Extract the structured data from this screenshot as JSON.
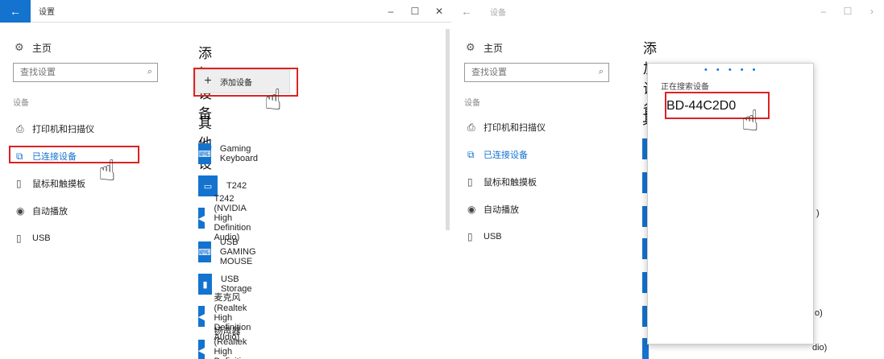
{
  "left_window": {
    "title": "设置",
    "back_glyph": "←",
    "minimize_glyph": "–",
    "maximize_glyph": "☐",
    "close_glyph": "✕",
    "sidebar": {
      "home_label": "主页",
      "search_placeholder": "查找设置",
      "group_label": "设备",
      "items": [
        {
          "label": "打印机和扫描仪",
          "icon": "printer-icon"
        },
        {
          "label": "已连接设备",
          "icon": "connected-devices-icon",
          "active": true
        },
        {
          "label": "鼠标和触摸板",
          "icon": "mouse-icon"
        },
        {
          "label": "自动播放",
          "icon": "autoplay-icon"
        },
        {
          "label": "USB",
          "icon": "usb-icon"
        }
      ]
    },
    "content": {
      "add_heading": "添加设备",
      "add_button_label": "添加设备",
      "other_heading": "其他设备",
      "devices": [
        {
          "name": "Gaming Keyboard",
          "icon": "keyboard-icon"
        },
        {
          "name": "T242",
          "icon": "monitor-icon"
        },
        {
          "name": "T242 (NVIDIA High Definition Audio)",
          "icon": "speaker-icon"
        },
        {
          "name": "USB GAMING MOUSE",
          "icon": "keyboard-icon"
        },
        {
          "name": "USB Storage",
          "icon": "usb-storage-icon"
        },
        {
          "name": "麦克风 (Realtek High Definition Audio)",
          "icon": "speaker-icon"
        },
        {
          "name": "扬声器 (Realtek High Definition Audio)",
          "icon": "speaker-icon"
        }
      ]
    }
  },
  "right_window": {
    "title": "设备",
    "back_glyph": "←",
    "minimize_glyph": "–",
    "maximize_glyph": "☐",
    "close_glyph": "›",
    "sidebar": {
      "home_label": "主页",
      "search_placeholder": "查找设置",
      "group_label": "设备",
      "items": [
        {
          "label": "打印机和扫描仪"
        },
        {
          "label": "已连接设备",
          "active": true
        },
        {
          "label": "鼠标和触摸板"
        },
        {
          "label": "自动播放"
        },
        {
          "label": "USB"
        }
      ]
    },
    "content": {
      "add_heading": "添加设备",
      "partial_heading": "其",
      "partial_texts": [
        ")",
        "o)",
        "dio)"
      ]
    },
    "popup": {
      "progress_dots": "• • • • •",
      "status_text": "正在搜索设备",
      "found_device": "BD-44C2D0"
    }
  },
  "colors": {
    "accent": "#1473cf",
    "highlight_red": "#d22222"
  }
}
